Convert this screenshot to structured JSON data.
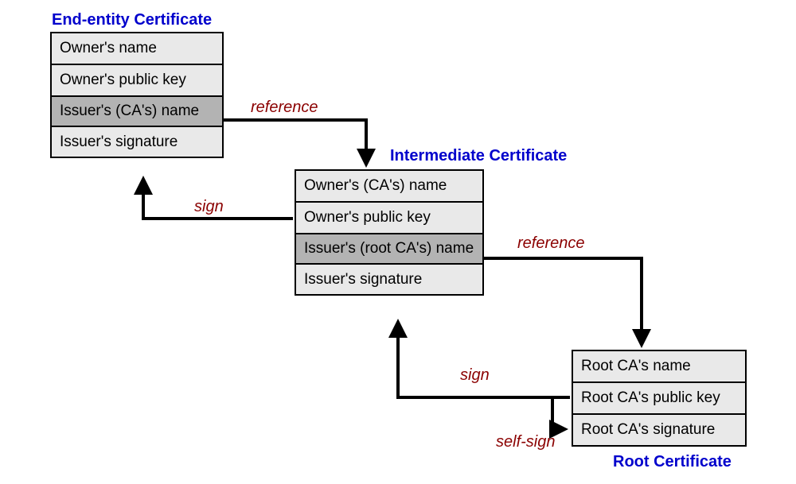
{
  "titles": {
    "end_entity": "End-entity Certificate",
    "intermediate": "Intermediate Certificate",
    "root": "Root Certificate"
  },
  "end_entity": {
    "r0": "Owner's name",
    "r1": "Owner's public key",
    "r2": "Issuer's (CA's) name",
    "r3": "Issuer's signature"
  },
  "intermediate": {
    "r0": "Owner's (CA's) name",
    "r1": "Owner's public key",
    "r2": "Issuer's (root CA's) name",
    "r3": "Issuer's signature"
  },
  "root": {
    "r0": "Root CA's name",
    "r1": "Root CA's public key",
    "r2": "Root CA's signature"
  },
  "labels": {
    "reference": "reference",
    "sign": "sign",
    "self_sign": "self-sign"
  }
}
